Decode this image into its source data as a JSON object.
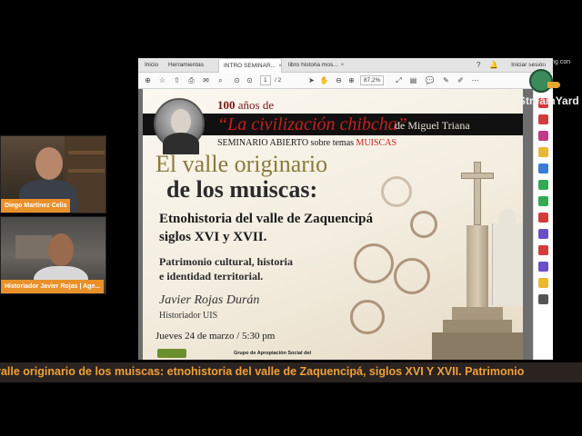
{
  "speakers": [
    {
      "name": "Diego Martínez Celis"
    },
    {
      "name": "Historiador Javier Rojas | Age..."
    }
  ],
  "browser": {
    "menu": [
      "Inicio",
      "Herramientas"
    ],
    "tabs": [
      {
        "label": "INTRO SEMINAR...",
        "active": true
      },
      {
        "label": "libro historia mos...",
        "active": false
      }
    ],
    "sign_in": "Iniciar sesión",
    "page_current": "1",
    "page_total": "/ 2",
    "zoom": "87,2%"
  },
  "poster": {
    "years_num": "100",
    "years_word": " años de",
    "civ_title": "“La civilización chibcha”",
    "civ_by": "de Miguel Triana",
    "seminar_prefix": "SEMINARIO ABIERTO sobre temas ",
    "seminar_topic": "MUISCAS",
    "title_line1": "El valle originario",
    "title_line2": "de los muiscas:",
    "subtitle_line1": "Etnohistoria del valle de Zaquencipá",
    "subtitle_line2": "siglos XVI y XVII.",
    "theme_line1": "Patrimonio cultural, historia",
    "theme_line2": "e identidad territorial.",
    "author": "Javier Rojas Durán",
    "role": "Historiador UIS",
    "date": "Jueves 24 de marzo / 5:30 pm",
    "footer_org": "Grupo de Apropiación Social del"
  },
  "watermark": {
    "top_text": "Streaming con",
    "brand": "StreamYard"
  },
  "ticker": {
    "text": "valle originario de los muiscas: etnohistoria del valle de Zaquencipá, siglos XVI Y XVII. Patrimonio"
  },
  "colors": {
    "name_tag": "#e8912a",
    "ticker_text": "#f0a03a",
    "poster_red": "#c61f1f"
  }
}
